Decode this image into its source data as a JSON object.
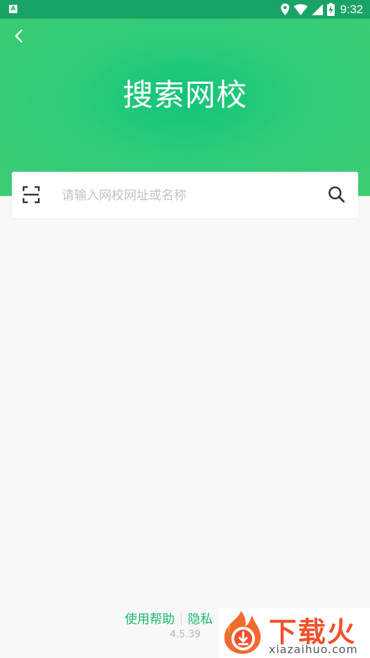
{
  "status_bar": {
    "notification_icon": "A",
    "time": "9:32",
    "icons": [
      "location-icon",
      "wifi-icon",
      "cellular-icon",
      "battery-charging-icon"
    ]
  },
  "header": {
    "title": "搜索网校",
    "back_icon": "chevron-left-icon"
  },
  "search": {
    "placeholder": "请输入网校网址或名称",
    "value": "",
    "scan_icon": "scan-icon",
    "search_icon": "search-icon"
  },
  "footer": {
    "help_label": "使用帮助",
    "privacy_label": "隐私",
    "version": "4.5.39"
  },
  "watermark": {
    "brand": "下载火",
    "url": "xiazaihuo.com"
  },
  "colors": {
    "status_bar": "#1aa366",
    "header_green": "#2ecc7a",
    "link_green": "#1fb870",
    "watermark_orange": "#f0522e"
  }
}
